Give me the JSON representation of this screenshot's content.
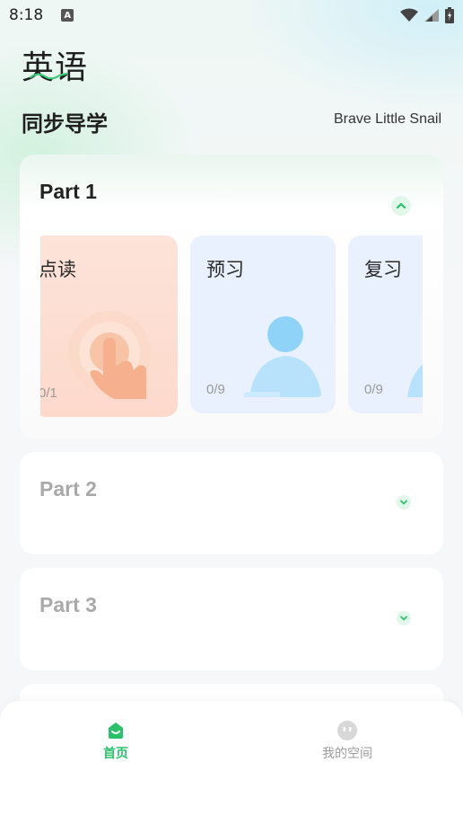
{
  "status_bar": {
    "time": "8:18",
    "notification_icon": "A"
  },
  "header": {
    "subject": "英语",
    "section": "同步导学",
    "book": "Brave Little Snail"
  },
  "parts": [
    {
      "title": "Part 1",
      "expanded": true,
      "activities": [
        {
          "label": "点读",
          "progress": "0/1",
          "icon": "hand-tap-icon",
          "color": "#fde3d9"
        },
        {
          "label": "预习",
          "progress": "0/9",
          "icon": "person-icon",
          "color": "#e8f1fd"
        },
        {
          "label": "复习",
          "progress": "0/9",
          "icon": "person-icon",
          "color": "#e8f1fd"
        }
      ]
    },
    {
      "title": "Part 2",
      "expanded": false
    },
    {
      "title": "Part 3",
      "expanded": false
    }
  ],
  "bottom_nav": {
    "items": [
      {
        "label": "首页",
        "icon": "home-icon",
        "active": true
      },
      {
        "label": "我的空间",
        "icon": "face-icon",
        "active": false
      }
    ]
  },
  "colors": {
    "accent": "#2bc16b",
    "inactive_title": "#a9a9a9"
  }
}
